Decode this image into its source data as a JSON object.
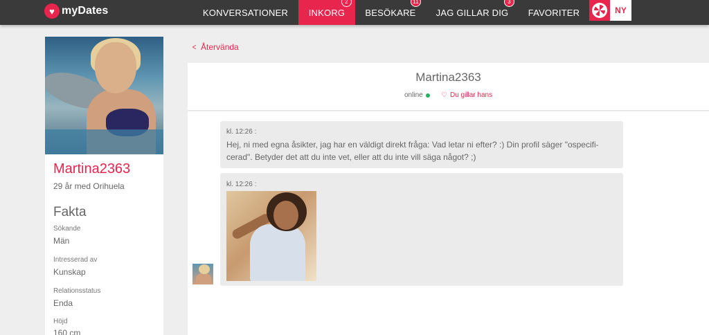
{
  "app": {
    "logo_text": "myDates",
    "accent_color": "#e8254c"
  },
  "nav": {
    "items": [
      {
        "label": "KONVERSATIONER",
        "badge": ""
      },
      {
        "label": "INKORG",
        "badge": "2",
        "active": true
      },
      {
        "label": "BESÖKARE",
        "badge": "11"
      },
      {
        "label": "JAG GILLAR DIG",
        "badge": "3"
      },
      {
        "label": "FAVORITER",
        "badge": ""
      }
    ],
    "lang_label": "NY"
  },
  "profile": {
    "name": "Martina2363",
    "subtitle": "29 år med Orihuela",
    "facts_title": "Fakta",
    "facts": [
      {
        "label": "Sökande",
        "value": "Män"
      },
      {
        "label": "Intresserad av",
        "value": "Kunskap"
      },
      {
        "label": "Relationsstatus",
        "value": "Enda"
      },
      {
        "label": "Höjd",
        "value": "160 cm"
      }
    ]
  },
  "main": {
    "back_label": "Återvända",
    "chat_title": "Martina2363",
    "status": "online",
    "status_color": "#27ae60",
    "like_label": "Du gillar hans",
    "messages": [
      {
        "time": "kl. 12:26 :",
        "text": "Hej, ni med egna åsikter, jag har en väldigt direkt fråga: Vad letar ni efter? :) Din profil säger \"ospecifi-cerad\". Betyder det att du inte vet, eller att du inte vill säga något? ;)"
      },
      {
        "time": "kl. 12:26 :",
        "type": "photo"
      }
    ]
  }
}
